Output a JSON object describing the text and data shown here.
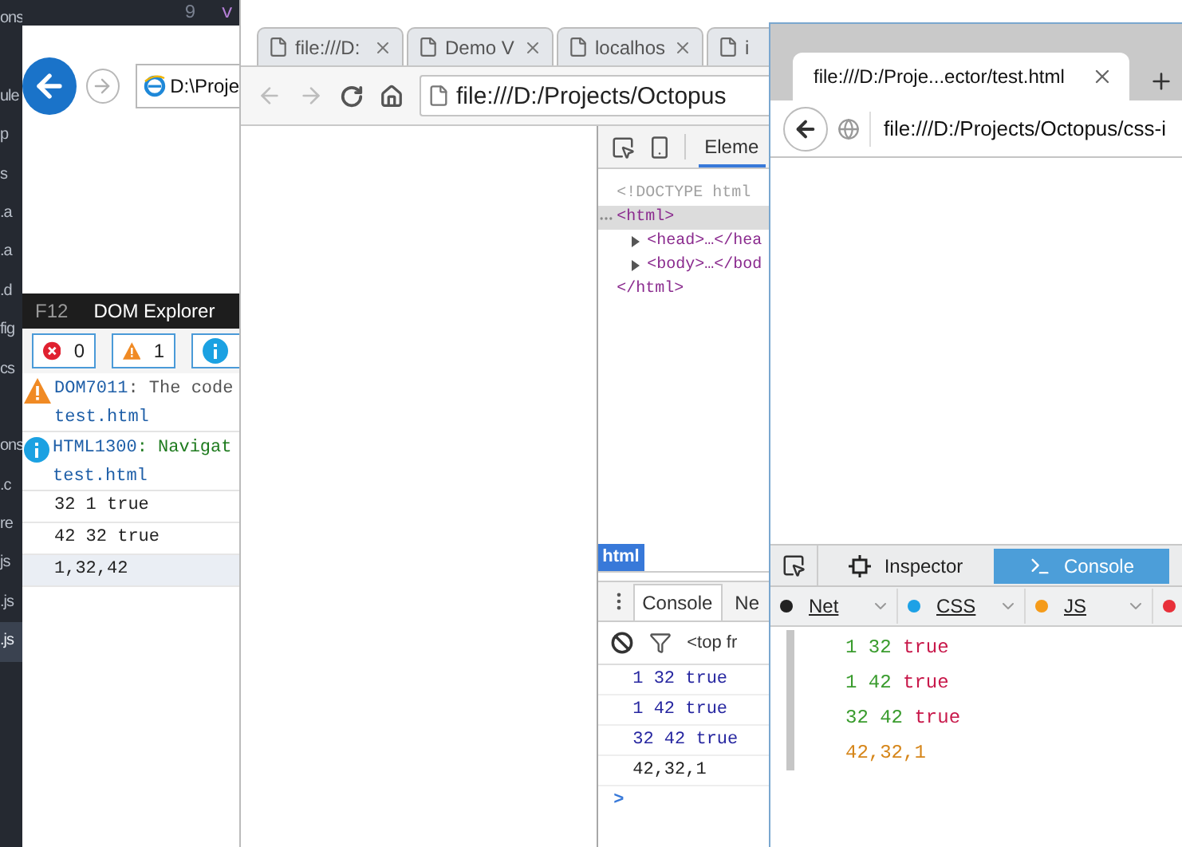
{
  "editor": {
    "line_number": "9",
    "code": "v",
    "explorer_groups": [
      [
        {
          "name": "ons",
          "selected": false
        }
      ],
      [
        {
          "name": "ule",
          "selected": false
        },
        {
          "name": "p",
          "selected": false
        },
        {
          "name": "s",
          "selected": false
        },
        {
          "name": ".a",
          "selected": false
        },
        {
          "name": ".a",
          "selected": false
        },
        {
          "name": ".d",
          "selected": false
        },
        {
          "name": "fig",
          "selected": false
        },
        {
          "name": "cs",
          "selected": false
        }
      ],
      [
        {
          "name": "ons",
          "selected": false
        },
        {
          "name": ".c",
          "selected": false
        },
        {
          "name": "re",
          "selected": false
        },
        {
          "name": "js",
          "selected": false
        },
        {
          "name": ".js",
          "selected": false
        },
        {
          "name": ".js",
          "selected": true
        }
      ]
    ]
  },
  "ie_window": {
    "address": "D:\\Proje",
    "devtools": {
      "key": "F12",
      "title": "DOM Explorer",
      "counters": [
        {
          "kind": "error",
          "count": "0"
        },
        {
          "kind": "warning",
          "count": "1"
        },
        {
          "kind": "info"
        }
      ],
      "messages": [
        {
          "kind": "warning",
          "code": "DOM7011",
          "text": ": The code",
          "source": "test.html"
        },
        {
          "kind": "info",
          "code": "HTML1300",
          "text": ": Navigat",
          "source": "test.html"
        }
      ],
      "log": [
        {
          "text": "32 1 true",
          "selected": false
        },
        {
          "text": "42 32 true",
          "selected": false
        },
        {
          "text": "1,32,42",
          "selected": true
        }
      ]
    }
  },
  "chrome_window": {
    "tabs": [
      {
        "title": "file:///D:"
      },
      {
        "title": "Demo V"
      },
      {
        "title": "localhos"
      },
      {
        "title": "i"
      }
    ],
    "address": "file:///D:/Projects/Octopus",
    "devtools": {
      "panel_tab": "Eleme",
      "dom_tree": [
        {
          "text": "<!DOCTYPE html",
          "kind": "doctype",
          "selected": false
        },
        {
          "text": "<html>",
          "kind": "tag",
          "selected": true,
          "children": [
            {
              "text": "<head>…</hea",
              "kind": "tag",
              "selected": false,
              "expanded": false
            },
            {
              "text": "<body>…</bod",
              "kind": "tag",
              "selected": false,
              "expanded": false
            }
          ]
        },
        {
          "text": "</html>",
          "kind": "tag",
          "selected": false
        }
      ],
      "breadcrumb": "html",
      "drawer_tabs": [
        {
          "label": "Console",
          "selected": true
        },
        {
          "label": "Ne",
          "selected": false
        }
      ],
      "context": "<top fr",
      "log": [
        {
          "text": "1 32 true",
          "kind": "log"
        },
        {
          "text": "1 42 true",
          "kind": "log"
        },
        {
          "text": "32 42 true",
          "kind": "log"
        },
        {
          "text": "42,32,1",
          "kind": "result"
        }
      ],
      "prompt": ">"
    }
  },
  "firefox_window": {
    "tab_title": "file:///D:/Proje...ector/test.html",
    "address": "file:///D:/Projects/Octopus/css-i",
    "devtools_tabs": [
      {
        "label": "Inspector",
        "kind": "inspector",
        "selected": false
      },
      {
        "label": "Console",
        "kind": "console",
        "selected": true
      }
    ],
    "filters": [
      {
        "label": "Net",
        "color": "#222222"
      },
      {
        "label": "CSS",
        "color": "#1da1e6"
      },
      {
        "label": "JS",
        "color": "#f59b1a"
      },
      {
        "color": "#e8303a"
      }
    ],
    "log": [
      [
        {
          "text": "1",
          "kind": "number"
        },
        {
          "text": "32",
          "kind": "number"
        },
        {
          "text": "true",
          "kind": "boolean"
        }
      ],
      [
        {
          "text": "1",
          "kind": "number"
        },
        {
          "text": "42",
          "kind": "number"
        },
        {
          "text": "true",
          "kind": "boolean"
        }
      ],
      [
        {
          "text": "32",
          "kind": "number"
        },
        {
          "text": "42",
          "kind": "number"
        },
        {
          "text": "true",
          "kind": "boolean"
        }
      ],
      [
        {
          "text": "42,32,1",
          "kind": "string"
        }
      ]
    ]
  }
}
